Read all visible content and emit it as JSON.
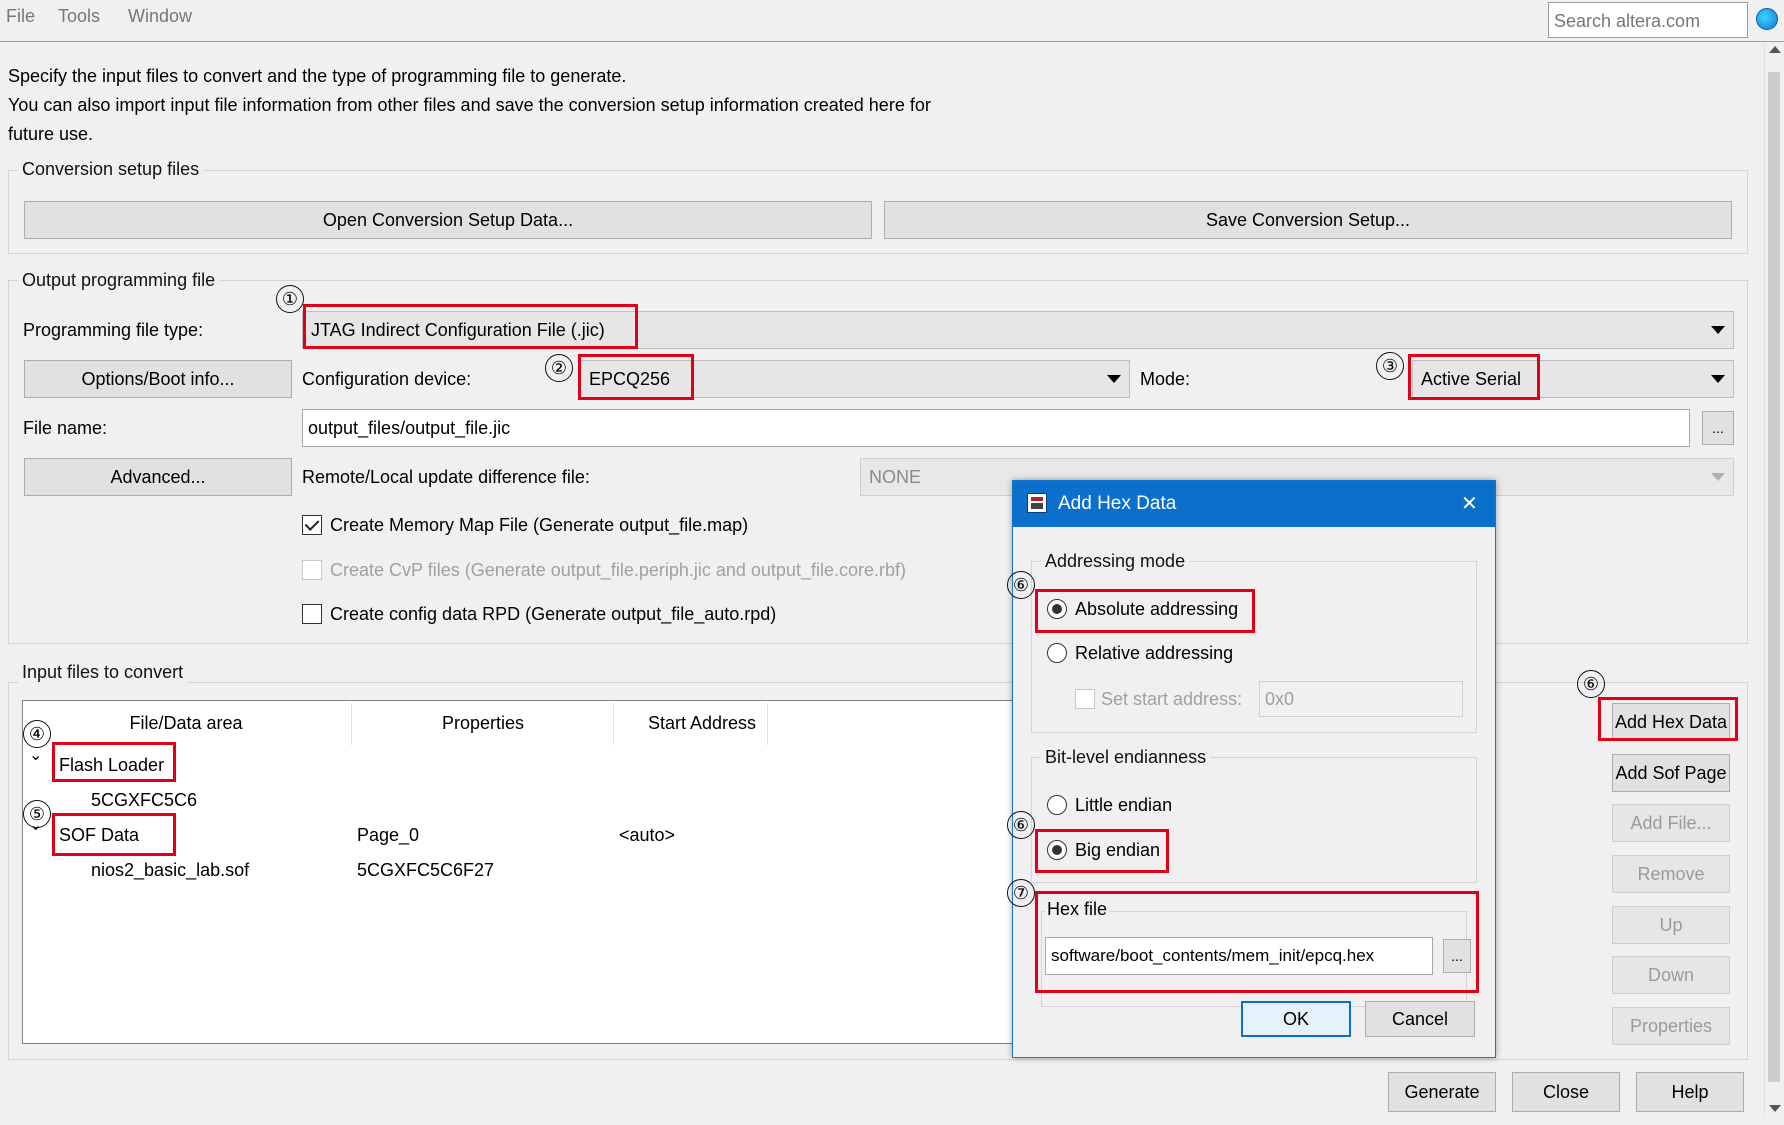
{
  "menu": {
    "items": [
      "File",
      "Tools",
      "Window"
    ]
  },
  "search": {
    "placeholder": "Search altera.com"
  },
  "description": {
    "line1": "Specify the input files to convert and the type of programming file to generate.",
    "line2": "You can also import input file information from other files and save the conversion setup information created here for",
    "line3": "future use."
  },
  "setup": {
    "title": "Conversion setup files",
    "open_label": "Open Conversion Setup Data...",
    "save_label": "Save Conversion Setup..."
  },
  "output": {
    "title": "Output programming file",
    "type_label": "Programming file type:",
    "type_value": "JTAG Indirect Configuration File (.jic)",
    "options_label": "Options/Boot info...",
    "device_label": "Configuration device:",
    "device_value": "EPCQ256",
    "mode_label": "Mode:",
    "mode_value": "Active Serial",
    "filename_label": "File name:",
    "filename_value": "output_files/output_file.jic",
    "browse_label": "...",
    "advanced_label": "Advanced...",
    "remote_label": "Remote/Local update difference file:",
    "remote_value": "NONE",
    "check_memmap": "Create Memory Map File (Generate output_file.map)",
    "check_cvp": "Create CvP files (Generate output_file.periph.jic and output_file.core.rbf)",
    "check_rpd": "Create config data RPD (Generate output_file_auto.rpd)"
  },
  "input": {
    "title": "Input files to convert",
    "columns": [
      "File/Data area",
      "Properties",
      "Start Address"
    ],
    "rows": {
      "flash_loader": "Flash Loader",
      "flash_device": "5CGXFC5C6",
      "sof_data": "SOF Data",
      "sof_props": "Page_0",
      "sof_addr": "<auto>",
      "sof_file": "nios2_basic_lab.sof",
      "sof_file_props": "5CGXFC5C6F27"
    },
    "buttons": {
      "add_hex": "Add Hex Data",
      "add_sof": "Add Sof Page",
      "add_file": "Add File...",
      "remove": "Remove",
      "up": "Up",
      "down": "Down",
      "properties": "Properties"
    }
  },
  "footer": {
    "generate": "Generate",
    "close": "Close",
    "help": "Help"
  },
  "dialog": {
    "title": "Add Hex Data",
    "close_glyph": "✕",
    "addressing_title": "Addressing mode",
    "absolute": "Absolute addressing",
    "relative": "Relative addressing",
    "set_start": "Set start address:",
    "start_value": "0x0",
    "endian_title": "Bit-level endianness",
    "little": "Little endian",
    "big": "Big endian",
    "hexfile_title": "Hex file",
    "hexfile_value": "software/boot_contents/mem_init/epcq.hex",
    "browse": "...",
    "ok": "OK",
    "cancel": "Cancel"
  },
  "annotations": {
    "n1": "①",
    "n2": "②",
    "n3": "③",
    "n4": "④",
    "n5": "⑤",
    "n6": "⑥",
    "n7": "⑦"
  },
  "colors": {
    "highlight": "#e0001a",
    "title_bar": "#0b6fcc"
  }
}
